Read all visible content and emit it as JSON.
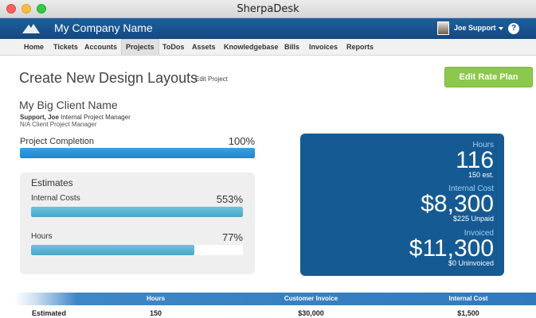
{
  "window": {
    "title": "SherpaDesk"
  },
  "header": {
    "company": "My Company Name",
    "user": "Joe Support",
    "help": "?"
  },
  "nav": {
    "items": [
      "Home",
      "Tickets",
      "Accounts",
      "Projects",
      "ToDos",
      "Assets",
      "Knowledgebase",
      "Bills",
      "Invoices",
      "Reports"
    ],
    "active": "Projects"
  },
  "page": {
    "title": "Create New Design Layouts",
    "edit_link": "Edit Project",
    "rate_button": "Edit Rate Plan",
    "client_name": "My Big Client Name",
    "manager_name": "Support, Joe",
    "manager_role": "Internal Project Manager",
    "client_manager": "N/A Client Project Manager"
  },
  "completion": {
    "label": "Project Completion",
    "value": "100%",
    "fraction": 1.0
  },
  "estimates": {
    "title": "Estimates",
    "internal_costs": {
      "label": "Internal Costs",
      "value": "553%",
      "fraction": 1.0
    },
    "hours": {
      "label": "Hours",
      "value": "77%",
      "fraction": 0.77
    }
  },
  "stats": {
    "hours_label": "Hours",
    "hours_value": "116",
    "hours_sub": "150 est.",
    "cost_label": "Internal Cost",
    "cost_value": "$8,300",
    "cost_sub": "$225 Unpaid",
    "invoiced_label": "Invoiced",
    "invoiced_value": "$11,300",
    "invoiced_sub": "$0 Uninvoiced"
  },
  "table": {
    "headers": [
      "Hours",
      "Customer Invoice",
      "Internal Cost"
    ],
    "rows": [
      {
        "label": "Estimated",
        "cells": [
          "150",
          "$30,000",
          "$1,500"
        ]
      }
    ]
  },
  "colors": {
    "header_blue": "#15487e",
    "panel_blue": "#155a93",
    "accent_green": "#8cc84b",
    "bar_blue": "#1d87d2"
  }
}
